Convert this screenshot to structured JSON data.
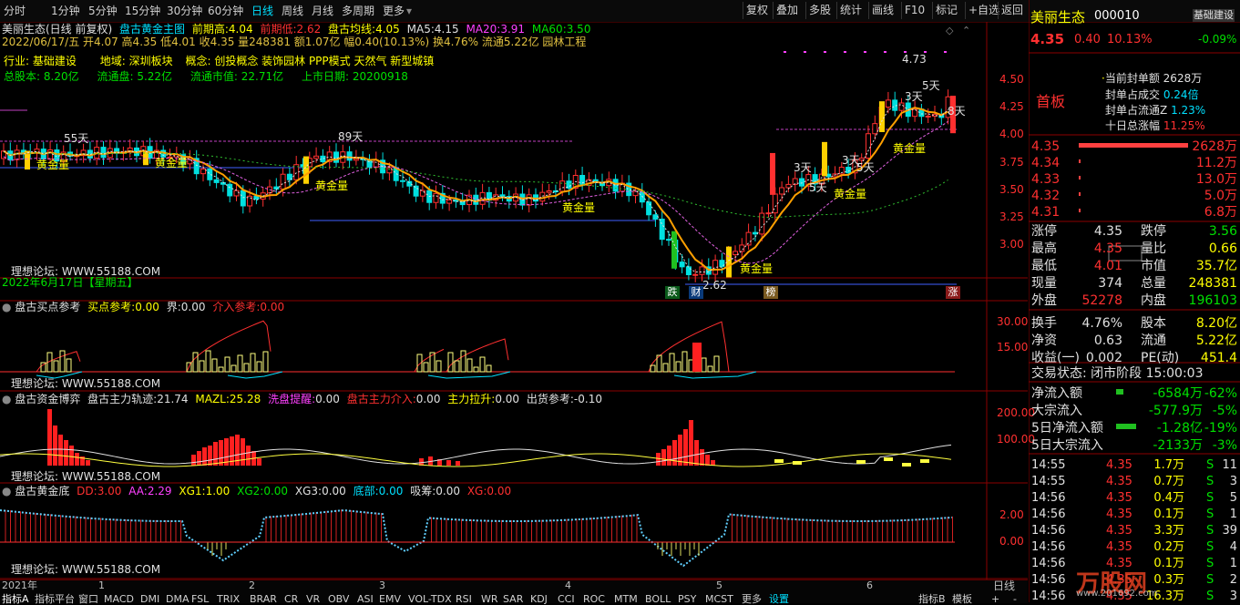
{
  "toolbar": {
    "periods": [
      "分时",
      "1分钟",
      "5分钟",
      "15分钟",
      "30分钟",
      "60分钟",
      "日线",
      "周线",
      "月线",
      "多周期",
      "更多"
    ],
    "active": "日线",
    "right": [
      "复权",
      "叠加",
      "多股",
      "统计",
      "画线",
      "F10",
      "标记",
      "+自选",
      "返回"
    ]
  },
  "header": {
    "stock_title": "美丽生态(日线 前复权)",
    "indicator_name": "盘古黄金主图",
    "prev_high_label": "前期高:",
    "prev_high": "4.04",
    "prev_low_label": "前期低:",
    "prev_low": "2.62",
    "avg_label": "盘古均线:",
    "avg": "4.05",
    "ma5_label": "MA5:",
    "ma5": "4.15",
    "ma20_label": "MA20:",
    "ma20": "3.91",
    "ma60_label": "MA60:",
    "ma60": "3.50",
    "ohlc_line": "2022/06/17/五 开4.07 高4.35 低4.01 收4.35 量248381 额1.07亿 幅0.40(10.13%) 换4.76% 流通5.22亿 园林工程",
    "industry_label": "行业:",
    "industry": "基础建设",
    "region_label": "地域:",
    "region": "深圳板块",
    "concept_label": "概念:",
    "concept": "创投概念 装饰园林 PPP模式 天然气 新型城镇",
    "total_shares_label": "总股本:",
    "total_shares": "8.20亿",
    "float_label": "流通盘:",
    "float": "5.22亿",
    "float_mv_label": "流通市值:",
    "float_mv": "22.71亿",
    "ipo_label": "上市日期:",
    "ipo": "20200918"
  },
  "main_chart": {
    "forum": "理想论坛: WWW.55188.COM",
    "date_stamp": "2022年6月17日【星期五】",
    "annotations": [
      "55天",
      "89天",
      "3天",
      "5天",
      "8天",
      "3天",
      "5天",
      "3天",
      "5天",
      "4.73",
      "2.62"
    ],
    "gold_label": "黄金量",
    "badges": [
      "跌",
      "财",
      "榜",
      "涨"
    ],
    "y_ticks": [
      "4.50",
      "4.25",
      "4.00",
      "3.75",
      "3.50",
      "3.25",
      "3.00"
    ]
  },
  "panel1": {
    "name": "盘古买点参考",
    "v1_label": "买点参考:",
    "v1": "0.00",
    "v2_label": "界:",
    "v2": "0.00",
    "v3_label": "介入参考:",
    "v3": "0.00",
    "forum": "理想论坛: WWW.55188.COM",
    "y_ticks": [
      "30.00",
      "15.00"
    ]
  },
  "panel2": {
    "name": "盘古资金博弈",
    "v1_label": "盘古主力轨迹:",
    "v1": "21.74",
    "v2_label": "MAZL:",
    "v2": "25.28",
    "v3_label": "洗盘提醒:",
    "v3": "0.00",
    "v4_label": "盘古主力介入:",
    "v4": "0.00",
    "v5_label": "主力拉升:",
    "v5": "0.00",
    "v6_label": "出货参考:",
    "v6": "-0.10",
    "forum": "理想论坛: WWW.55188.COM",
    "y_ticks": [
      "200.00",
      "100.00"
    ]
  },
  "panel3": {
    "name": "盘古黄金底",
    "v1_label": "DD:",
    "v1": "3.00",
    "v2_label": "AA:",
    "v2": "2.29",
    "v3_label": "XG1:",
    "v3": "1.00",
    "v4_label": "XG2:",
    "v4": "0.00",
    "v5_label": "XG3:",
    "v5": "0.00",
    "v6_label": "底部:",
    "v6": "0.00",
    "v7_label": "吸筹:",
    "v7": "0.00",
    "v8_label": "XG:",
    "v8": "0.00",
    "forum": "理想论坛: WWW.55188.COM",
    "y_ticks": [
      "2.00",
      "0.00"
    ]
  },
  "time_axis": [
    "2021年",
    "1",
    "2",
    "3",
    "4",
    "5",
    "6"
  ],
  "period_label": "日线",
  "bottom_tabs": [
    "指标A",
    "指标平台",
    "窗口",
    "MACD",
    "DMI",
    "DMA",
    "FSL",
    "TRIX",
    "BRAR",
    "CR",
    "VR",
    "OBV",
    "ASI",
    "EMV",
    "VOL-TDX",
    "RSI",
    "WR",
    "SAR",
    "KDJ",
    "CCI",
    "ROC",
    "MTM",
    "BOLL",
    "PSY",
    "MCST",
    "更多",
    "设置"
  ],
  "bottom_right": [
    "指标B",
    "模板"
  ],
  "quote": {
    "name": "美丽生态",
    "code": "000010",
    "sector_btn": "基础建设",
    "price": "4.35",
    "change": "0.40",
    "pct": "10.13%",
    "sector_pct": "-0.09%",
    "board": "首板",
    "seal_amt_label": "当前封单额",
    "seal_amt": "2628万",
    "seal_ratio_label": "封单占成交",
    "seal_ratio": "0.24倍",
    "seal_float_label": "封单占流通Z",
    "seal_float": "1.23%",
    "ten_day_label": "十日总涨幅",
    "ten_day": "11.25%",
    "bids": [
      {
        "p": "4.35",
        "v": "2628万",
        "w": 1.0
      },
      {
        "p": "4.34",
        "v": "11.2万",
        "w": 0.0
      },
      {
        "p": "4.33",
        "v": "13.0万",
        "w": 0.0
      },
      {
        "p": "4.32",
        "v": "5.0万",
        "w": 0.0
      },
      {
        "p": "4.31",
        "v": "6.8万",
        "w": 0.0
      }
    ],
    "stats": [
      [
        "涨停",
        "4.35",
        "跌停",
        "3.56"
      ],
      [
        "最高",
        "4.35",
        "量比",
        "0.66"
      ],
      [
        "最低",
        "4.01",
        "市值",
        "35.7亿"
      ],
      [
        "现量",
        "374",
        "总量",
        "248381"
      ],
      [
        "外盘",
        "52278",
        "内盘",
        "196103"
      ],
      [
        "换手",
        "4.76%",
        "股本",
        "8.20亿"
      ],
      [
        "净资",
        "0.63",
        "流通",
        "5.22亿"
      ],
      [
        "收益(一)",
        "0.002",
        "PE(动)",
        "451.4"
      ]
    ],
    "trade_status": "交易状态: 闭市阶段 15:00:03",
    "flows": [
      [
        "净流入额",
        "-6584万",
        "-62%"
      ],
      [
        "大宗流入",
        "-577.9万",
        "-5%"
      ],
      [
        "5日净流入额",
        "-1.28亿",
        "-19%"
      ],
      [
        "5日大宗流入",
        "-2133万",
        "-3%"
      ]
    ],
    "ticks": [
      [
        "14:55",
        "4.35",
        "1.7万",
        "S",
        "11"
      ],
      [
        "14:55",
        "4.35",
        "0.7万",
        "S",
        "3"
      ],
      [
        "14:56",
        "4.35",
        "0.4万",
        "S",
        "5"
      ],
      [
        "14:56",
        "4.35",
        "0.1万",
        "S",
        "1"
      ],
      [
        "14:56",
        "4.35",
        "3.3万",
        "S",
        "39"
      ],
      [
        "14:56",
        "4.35",
        "0.2万",
        "S",
        "4"
      ],
      [
        "14:56",
        "4.35",
        "0.1万",
        "S",
        "1"
      ],
      [
        "14:56",
        "4.35",
        "0.3万",
        "S",
        "2"
      ],
      [
        "14:56",
        "4.35",
        "16.3万",
        "S",
        "3"
      ]
    ],
    "watermark": "万股网",
    "watermark_url": "www.201692.com"
  }
}
